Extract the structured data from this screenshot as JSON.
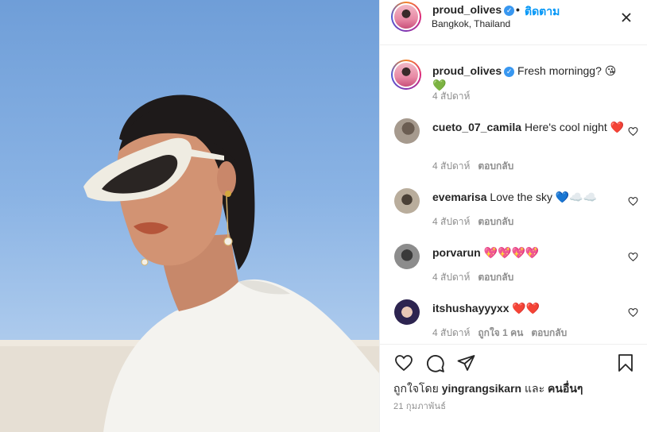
{
  "post": {
    "author": "proud_olives",
    "follow_label": "ติดตาม",
    "location": "Bangkok, Thailand",
    "more_icon": "more-horizontal-icon",
    "photo_alt": "Woman with white cat-eye sunglasses against blue sky"
  },
  "caption": {
    "username": "proud_olives",
    "text": "Fresh morningg? 😘💚",
    "time": "4 สัปดาห์"
  },
  "comments": [
    {
      "username": "cueto_07_camila",
      "text": "Here's cool night ❤️",
      "time": "4 สัปดาห์",
      "likes": "",
      "reply": "ตอบกลับ"
    },
    {
      "username": "evemarisa",
      "text": "Love the sky 💙☁️☁️",
      "time": "4 สัปดาห์",
      "likes": "",
      "reply": "ตอบกลับ"
    },
    {
      "username": "porvarun",
      "text": "💖💖💖💖",
      "time": "4 สัปดาห์",
      "likes": "",
      "reply": "ตอบกลับ"
    },
    {
      "username": "itshushayyyxx",
      "text": "❤️❤️",
      "time": "4 สัปดาห์",
      "likes": "ถูกใจ 1 คน",
      "reply": "ตอบกลับ"
    }
  ],
  "footer": {
    "liked_by_prefix": "ถูกใจโดย",
    "liked_by_user": "yingrangsikarn",
    "liked_by_and": "และ",
    "liked_by_others": "คนอื่นๆ",
    "date": "21 กุมภาพันธ์"
  },
  "colors": {
    "link": "#0095f6",
    "verified": "#3897f0",
    "muted": "#8e8e8e"
  }
}
